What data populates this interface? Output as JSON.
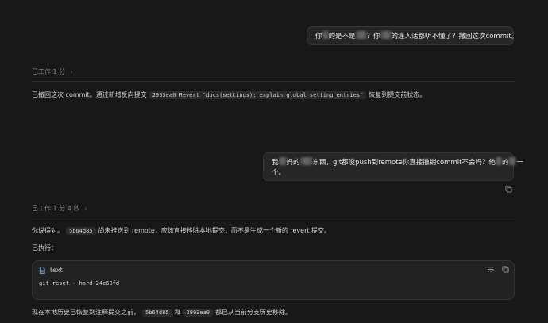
{
  "messages": [
    {
      "role": "user",
      "parts": [
        "你",
        "的是不是",
        "？你",
        "的连人话都听不懂了？撤回这次commit。"
      ]
    },
    {
      "role": "assistant",
      "worked_label": "已工作 1 分",
      "text_before": "已撤回这次 commit。通过新增反向提交",
      "code": "2993ea0 Revert \"docs(settings): explain global setting entries\"",
      "text_after": "恢复到提交前状态。"
    },
    {
      "role": "user",
      "line1": [
        "我",
        "妈的",
        "东西，git都没push到remote你直接撤销commit不会吗？他",
        "的",
        "一"
      ],
      "line2": "个。"
    },
    {
      "role": "assistant",
      "worked_label": "已工作 1 分 4 秒",
      "p1_before": "你说得对。",
      "p1_code": "5b64d85",
      "p1_after": "尚未推送到 remote，应该直接移除本地提交，而不是生成一个新的 revert 提交。",
      "p2": "已执行：",
      "codeblock": {
        "lang": "text",
        "code": "git reset --hard 24c60fd"
      },
      "p3_before": "现在本地历史已恢复到注释提交之前，",
      "p3_code1": "5b64d85",
      "p3_mid": "和",
      "p3_code2": "2993ea0",
      "p3_after": "都已从当前分支历史移除。"
    }
  ],
  "icons": {
    "chevron": "chevron-right-icon",
    "copy": "copy-icon",
    "file": "file-icon",
    "wrap": "wrap-lines-icon"
  }
}
